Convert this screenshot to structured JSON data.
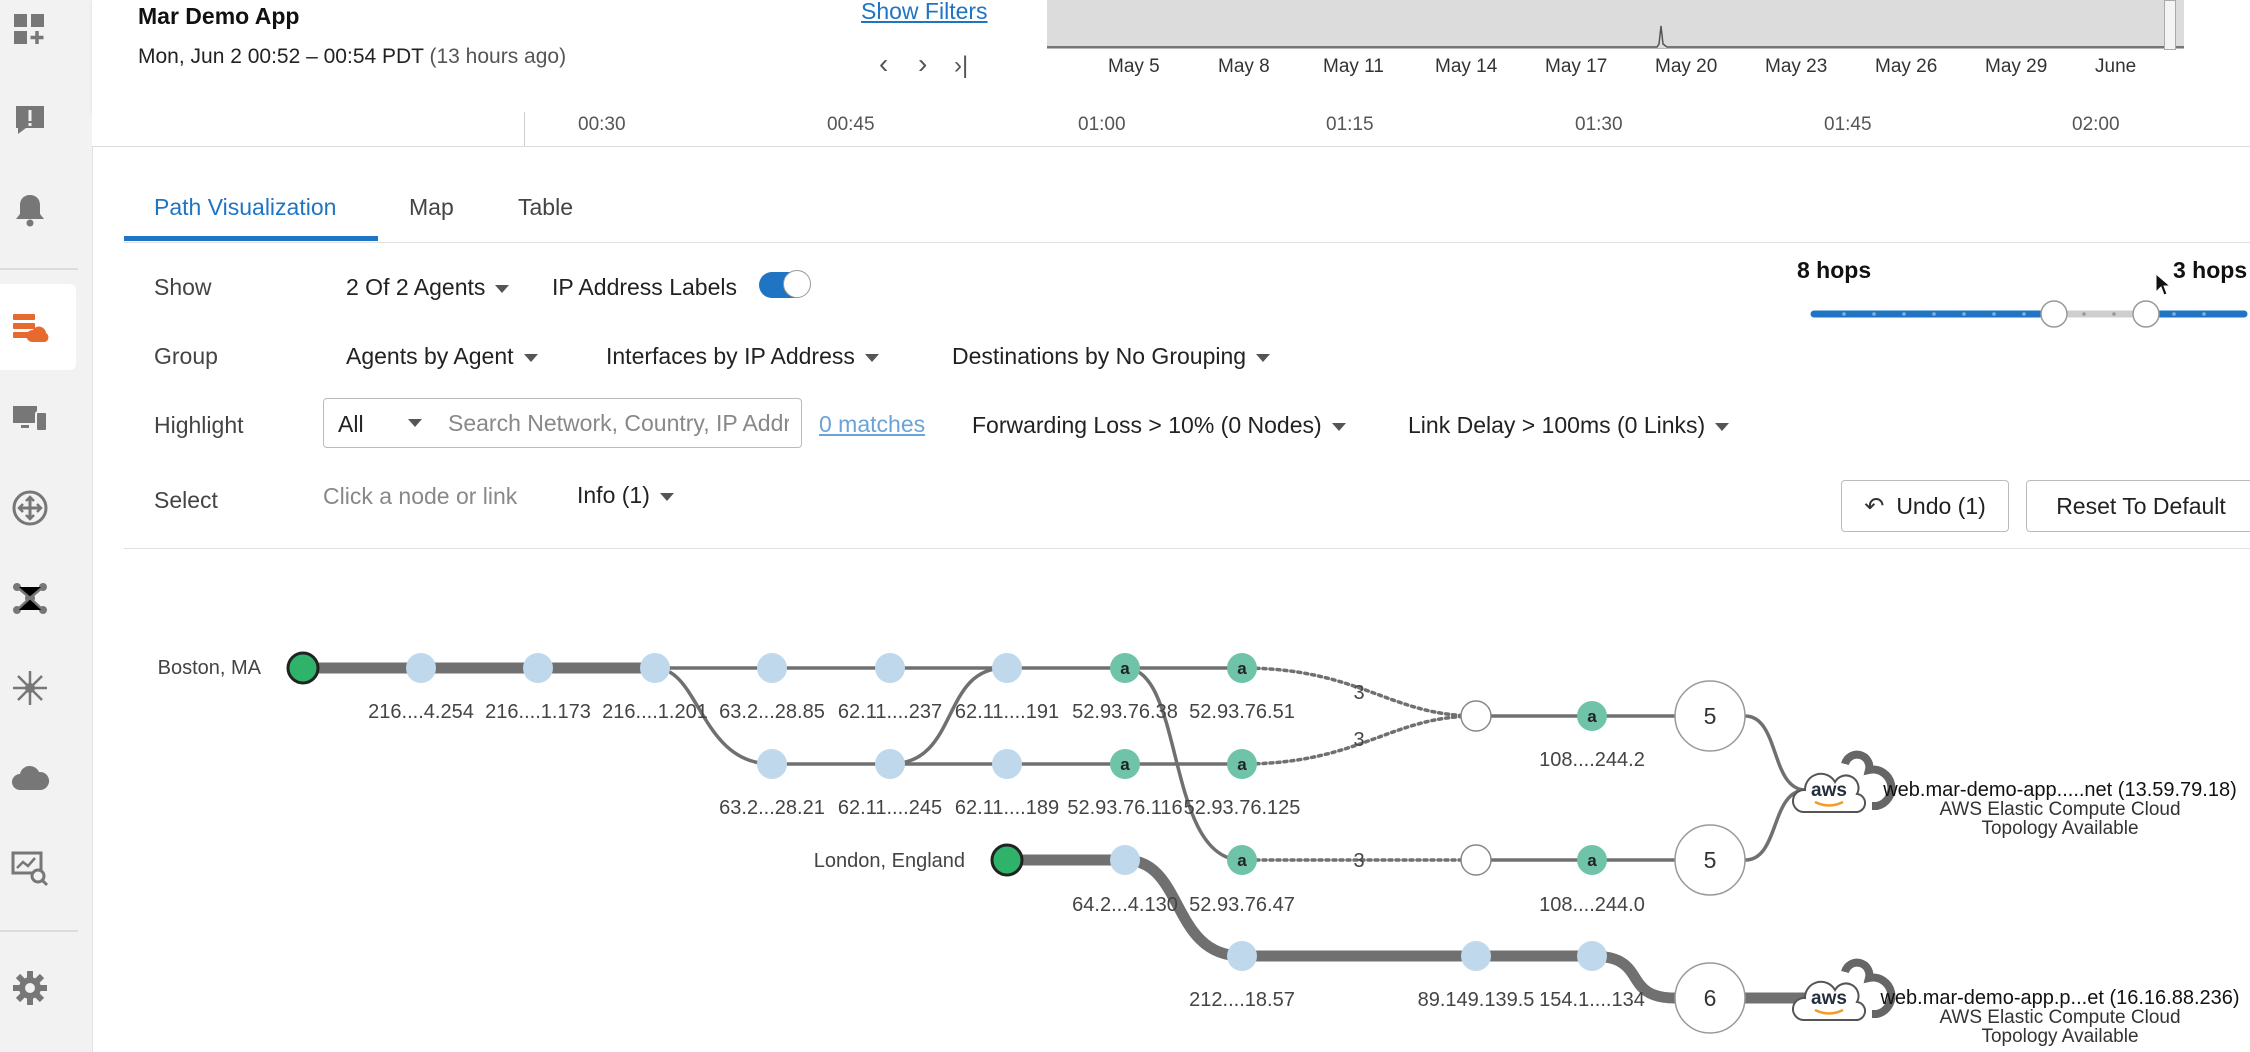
{
  "header": {
    "app_title": "Mar Demo App",
    "date_range": "Mon, Jun 2 00:52 – 00:54 PDT",
    "date_ago": "(13 hours ago)",
    "show_filters": "Show Filters",
    "nav": {
      "prev": "‹",
      "next": "›",
      "latest": "›|"
    },
    "mini_ticks": [
      "May 5",
      "May 8",
      "May 11",
      "May 14",
      "May 17",
      "May 20",
      "May 23",
      "May 26",
      "May 29",
      "June"
    ],
    "ruler_ticks": [
      "00:30",
      "00:45",
      "01:00",
      "01:15",
      "01:30",
      "01:45",
      "02:00"
    ]
  },
  "tabs": [
    "Path Visualization",
    "Map",
    "Table"
  ],
  "controls": {
    "show_label": "Show",
    "agents_dropdown": "2 Of 2 Agents",
    "ip_labels": "IP Address Labels",
    "ip_labels_on": true,
    "group_label": "Group",
    "group_agents": "Agents by Agent",
    "group_interfaces": "Interfaces by IP Address",
    "group_destinations": "Destinations by No Grouping",
    "highlight_label": "Highlight",
    "highlight_select": "All",
    "search_placeholder": "Search Network, Country, IP Address",
    "matches": "0 matches",
    "forwarding_loss": "Forwarding Loss > 10%  (0 Nodes)",
    "link_delay": "Link Delay > 100ms  (0 Links)",
    "select_label": "Select",
    "select_hint": "Click a node or link",
    "info_dropdown": "Info (1)",
    "undo_button": "Undo (1)",
    "reset_button": "Reset To Default",
    "hops_left": "8 hops",
    "hops_right": "3 hops"
  },
  "path": {
    "agents": [
      "Boston, MA",
      "London, England"
    ],
    "node_labels": {
      "b1": "216....4.254",
      "b2": "216....1.173",
      "b3": "216....1.201",
      "t1": "63.2...28.85",
      "t2": "62.11....237",
      "t3": "62.11....191",
      "t4": "52.93.76.38",
      "t5": "52.93.76.51",
      "m1": "63.2...28.21",
      "m2": "62.11....245",
      "m3": "62.11....189",
      "m4": "52.93.76.116",
      "m5": "52.93.76.125",
      "l1": "64.2...4.130",
      "l2": "52.93.76.47",
      "a1": "108....244.2",
      "a2": "108....244.0",
      "g1": "212....18.57",
      "g2": "89.149.139.5",
      "g3": "154.1....134"
    },
    "hidden_hop_count": "3",
    "cluster_counts": [
      "5",
      "5",
      "6"
    ],
    "destinations": [
      {
        "title": "web.mar-demo-app.....net (13.59.79.18)",
        "sub1": "AWS Elastic Compute Cloud",
        "sub2": "Topology Available"
      },
      {
        "title": "web.mar-demo-app.p...et (16.16.88.236)",
        "sub1": "AWS Elastic Compute Cloud",
        "sub2": "Topology Available"
      }
    ],
    "aws_logo_text": "aws",
    "amazon_glyph": "a"
  },
  "colors": {
    "accent": "#1f74c4",
    "agent_node": "#2fb36a",
    "hop_node": "#bfd8ec",
    "aws_node": "#6fc3a8",
    "link": "#707070",
    "active_rail_icon": "#e8692d"
  }
}
